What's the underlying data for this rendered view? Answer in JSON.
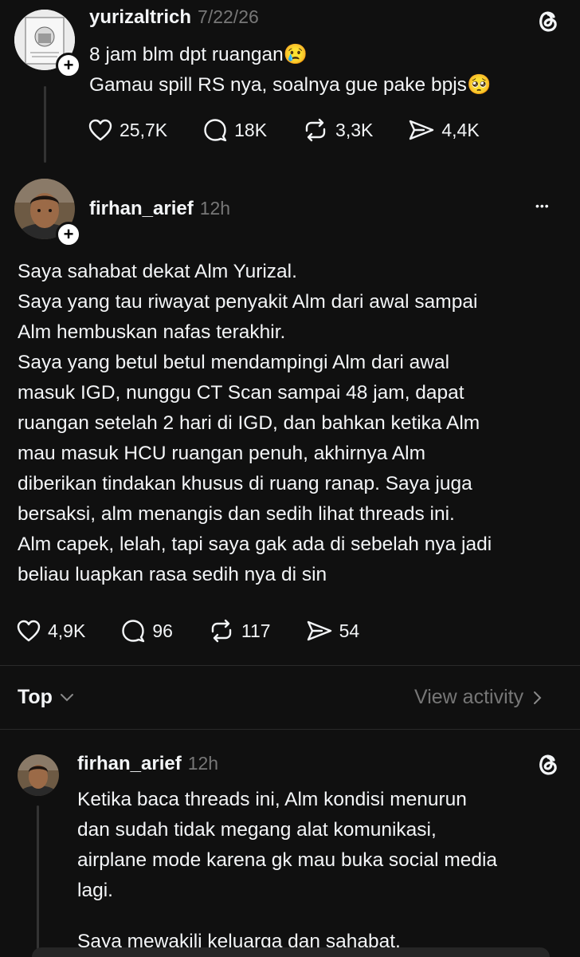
{
  "post1": {
    "username": "yurizaltrich",
    "time": "7/22/26",
    "lines": [
      "8 jam blm dpt ruangan",
      "Gamau spill RS nya, soalnya gue pake bpjs"
    ],
    "emoji1": "😢",
    "emoji2": "🥺",
    "stats": {
      "likes": "25,7K",
      "replies": "18K",
      "reposts": "3,3K",
      "shares": "4,4K"
    }
  },
  "post2": {
    "username": "firhan_arief",
    "time": "12h",
    "more": "•••",
    "paragraphs": [
      "Saya sahabat dekat Alm Yurizal.",
      "Saya yang tau riwayat penyakit Alm dari awal sampai Alm hembuskan nafas terakhir.",
      "Saya yang betul betul mendampingi Alm dari awal masuk IGD, nunggu CT Scan sampai 48 jam, dapat ruangan setelah 2 hari di IGD, dan bahkan ketika Alm mau masuk HCU ruangan penuh, akhirnya Alm diberikan tindakan khusus di ruang ranap. Saya juga bersaksi, alm menangis dan sedih lihat threads ini. Alm capek, lelah, tapi saya gak ada di sebelah nya jadi beliau luapkan rasa sedih nya di sin"
    ],
    "lines": [
      "Saya sahabat dekat Alm Yurizal.",
      "Saya yang tau riwayat penyakit Alm dari awal sampai",
      "Alm hembuskan nafas terakhir.",
      "Saya yang betul betul mendampingi Alm dari awal",
      "masuk IGD, nunggu CT Scan sampai 48 jam, dapat",
      "ruangan setelah 2 hari di IGD, dan bahkan ketika Alm",
      "mau masuk HCU ruangan penuh, akhirnya Alm",
      "diberikan tindakan khusus di ruang ranap. Saya juga",
      "bersaksi, alm menangis dan sedih lihat threads ini.",
      "Alm capek, lelah, tapi saya gak ada di sebelah nya jadi",
      "beliau luapkan rasa sedih nya di sin"
    ],
    "stats": {
      "likes": "4,9K",
      "replies": "96",
      "reposts": "117",
      "shares": "54"
    }
  },
  "sort": {
    "label": "Top",
    "activity": "View activity"
  },
  "reply": {
    "username": "firhan_arief",
    "time": "12h",
    "lines": [
      "Ketika baca threads ini, Alm kondisi menurun",
      "dan sudah tidak megang alat komunikasi,",
      "airplane mode karena gk mau buka social media",
      "lagi.",
      "",
      "Saya mewakili keluarga dan sahabat,"
    ]
  },
  "colors": {
    "background": "#101010",
    "text": "#f3f5f7",
    "muted": "#777777",
    "divider": "#2a2a2a"
  },
  "icons": [
    "threads-logo-icon",
    "heart-icon",
    "comment-icon",
    "repost-icon",
    "share-icon",
    "plus-icon",
    "more-icon",
    "chevron-down-icon",
    "chevron-right-icon"
  ]
}
